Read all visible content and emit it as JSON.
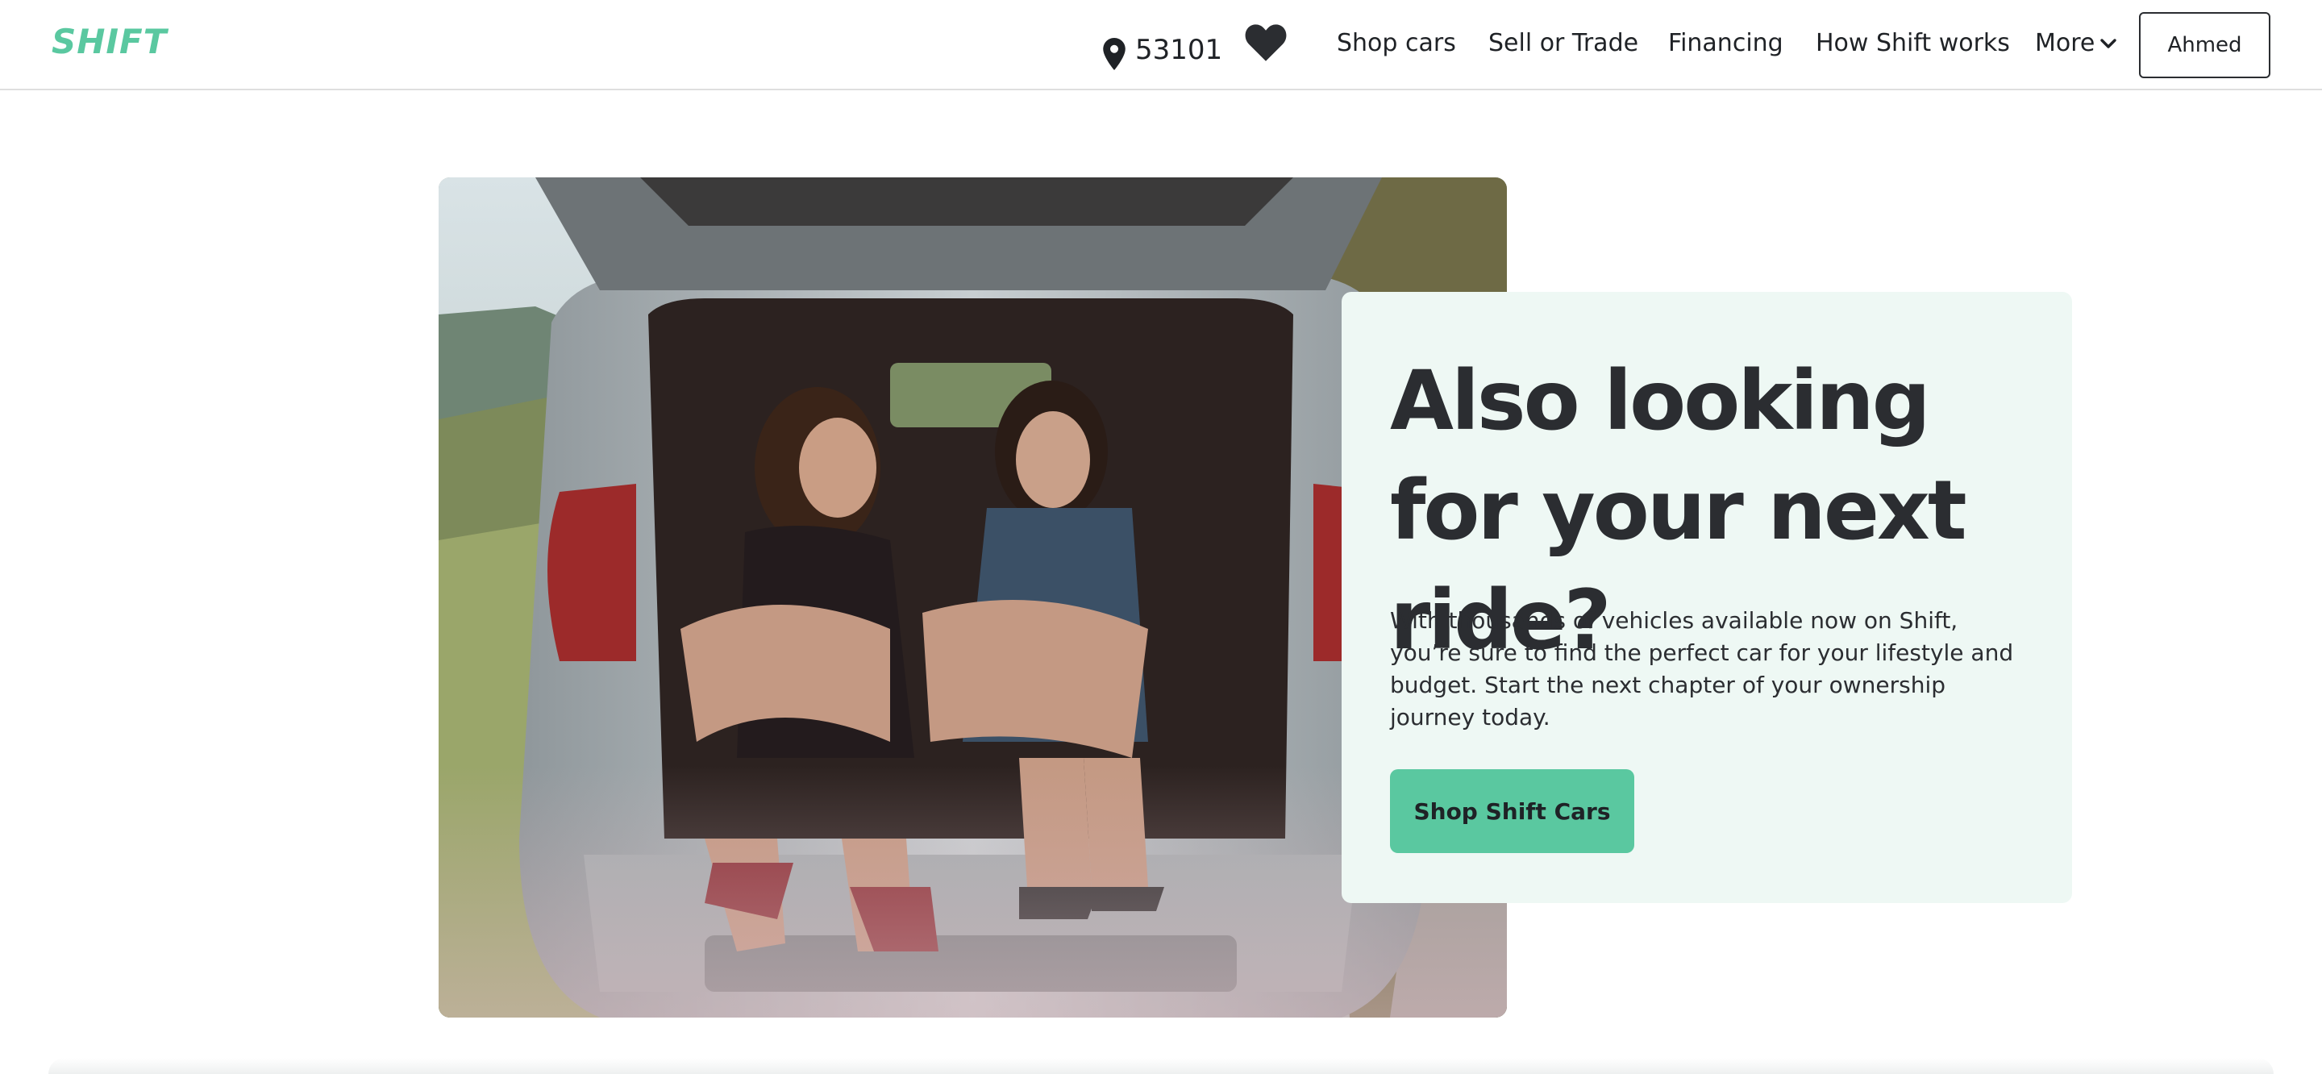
{
  "header": {
    "logo_text": "SHIFT",
    "zip_code": "53101",
    "nav": {
      "shop_cars": "Shop cars",
      "sell_or_trade": "Sell or Trade",
      "financing": "Financing",
      "how_shift_works": "How Shift works",
      "more": "More"
    },
    "user_button": "Ahmed"
  },
  "hero": {
    "title": "Also looking for your next ride?",
    "body": "With thousands of vehicles available now on Shift, you’re sure to find the perfect car for your lifestyle and budget. Start the next chapter of your ownership journey today.",
    "cta_label": "Shop Shift Cars"
  },
  "icons": {
    "location": "map-pin-icon",
    "favorites": "heart-icon",
    "more": "chevron-down-icon"
  },
  "colors": {
    "brand": "#5ac8a0",
    "card_background": "#eef8f4",
    "text": "#2b2d31"
  }
}
